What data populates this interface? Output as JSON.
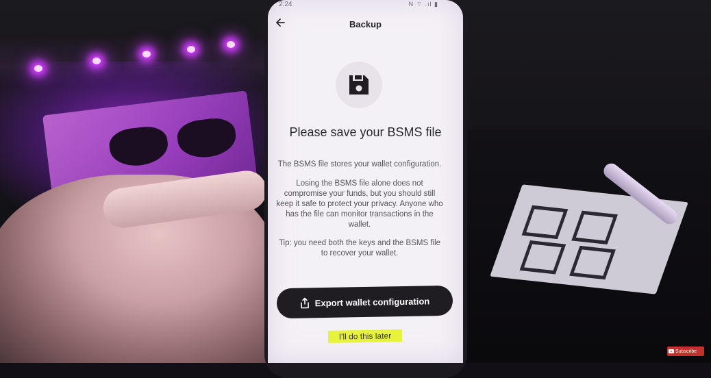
{
  "status_bar": {
    "time": "2:24",
    "icons": "N ⌔ .ıl ▮"
  },
  "header": {
    "title": "Backup",
    "back_icon": "arrow-left-icon"
  },
  "content": {
    "icon": "floppy-disk-icon",
    "heading": "Please save your BSMS file",
    "paragraph_1": "The BSMS file stores your wallet configuration.",
    "paragraph_2": "Losing the BSMS file alone does not compromise your funds, but you should still keep it safe to protect your privacy. Anyone who has the file can monitor transactions in the wallet.",
    "paragraph_3": "Tip: you need both the keys and the BSMS file to recover your wallet."
  },
  "actions": {
    "export_label": "Export wallet configuration",
    "export_icon": "share-upload-icon",
    "later_label": "I'll do this later"
  },
  "overlay": {
    "subscribe_label": "Subscribe"
  },
  "colors": {
    "accent_dark": "#1f1d22",
    "highlight": "#e6f23c",
    "led_purple": "#d23cff",
    "screen_bg": "#f4f1f6"
  }
}
